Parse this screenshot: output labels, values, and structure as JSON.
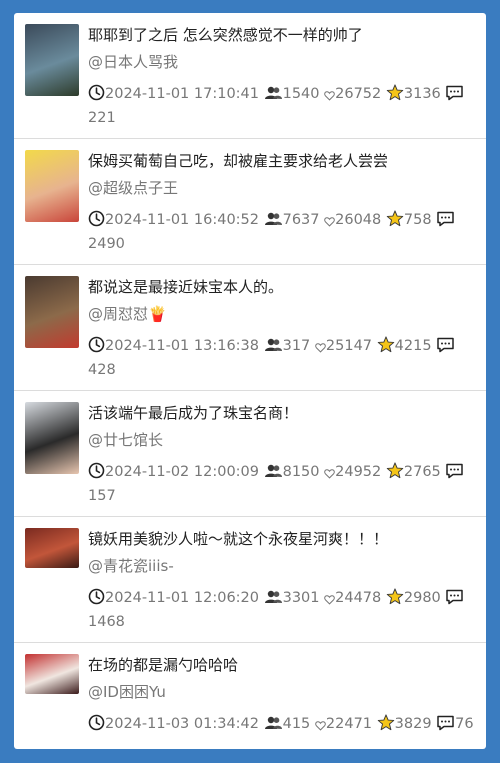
{
  "posts": [
    {
      "title": "耶耶到了之后 怎么突然感觉不一样的帅了",
      "author": "@日本人骂我",
      "time": "2024-11-01 17:10:41",
      "viewers": "1540",
      "likes": "26752",
      "stars": "3136",
      "comments": "221",
      "thumb_colors": [
        "#3b4a5a",
        "#6a8b9c",
        "#2d3b2a"
      ]
    },
    {
      "title": "保姆买葡萄自己吃，却被雇主要求给老人尝尝",
      "author": "@超级点子王",
      "time": "2024-11-01 16:40:52",
      "viewers": "7637",
      "likes": "26048",
      "stars": "758",
      "comments": "2490",
      "thumb_colors": [
        "#f2d94a",
        "#e7b38f",
        "#c9453a"
      ]
    },
    {
      "title": "都说这是最接近妹宝本人的。",
      "author": "@周怼怼",
      "author_badge": "🍟",
      "time": "2024-11-01 13:16:38",
      "viewers": "317",
      "likes": "25147",
      "stars": "4215",
      "comments": "428",
      "thumb_colors": [
        "#4a3a30",
        "#8c6a4a",
        "#c23a2e"
      ]
    },
    {
      "title": "活该端午最后成为了珠宝名商！",
      "author": "@廿七馆长",
      "time": "2024-11-02 12:00:09",
      "viewers": "8150",
      "likes": "24952",
      "stars": "2765",
      "comments": "157",
      "thumb_colors": [
        "#d7dbe0",
        "#2a2a2a",
        "#e8c6b0"
      ]
    },
    {
      "title": "镜妖用美貌沙人啦～就这个永夜星河爽！！！",
      "author": "@青花瓷iiis-",
      "time": "2024-11-01 12:06:20",
      "viewers": "3301",
      "likes": "24478",
      "stars": "2980",
      "comments": "1468",
      "thumb_colors": [
        "#7a2a20",
        "#c2563a",
        "#3a1a14"
      ]
    },
    {
      "title": "在场的都是漏勺哈哈哈",
      "author": "@ID困困Yu",
      "time": "2024-11-03 01:34:42",
      "viewers": "415",
      "likes": "22471",
      "stars": "3829",
      "comments": "76",
      "thumb_colors": [
        "#c23030",
        "#f0e6e0",
        "#3a1a1a"
      ]
    }
  ]
}
